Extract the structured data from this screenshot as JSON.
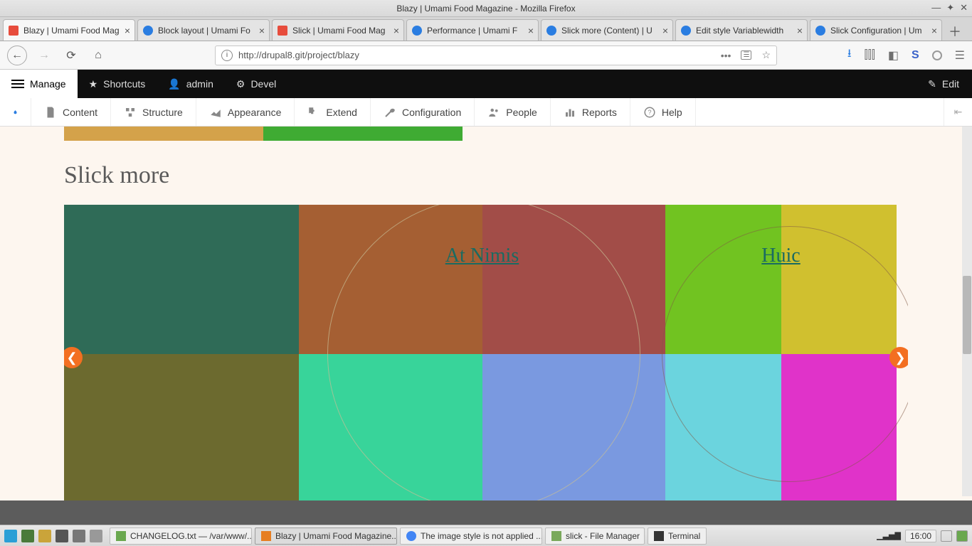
{
  "window": {
    "title": "Blazy | Umami Food Magazine - Mozilla Firefox"
  },
  "tabs": [
    {
      "label": "Blazy | Umami Food Mag",
      "icon": "red"
    },
    {
      "label": "Block layout | Umami Fo",
      "icon": "blue"
    },
    {
      "label": "Slick | Umami Food Mag",
      "icon": "red"
    },
    {
      "label": "Performance | Umami F",
      "icon": "blue"
    },
    {
      "label": "Slick more (Content) | U",
      "icon": "blue"
    },
    {
      "label": "Edit style Variablewidth",
      "icon": "blue"
    },
    {
      "label": "Slick Configuration | Um",
      "icon": "blue"
    }
  ],
  "url": "http://drupal8.git/project/blazy",
  "drupalBar": {
    "manage": "Manage",
    "shortcuts": "Shortcuts",
    "admin": "admin",
    "devel": "Devel",
    "edit": "Edit"
  },
  "adminMenu": {
    "content": "Content",
    "structure": "Structure",
    "appearance": "Appearance",
    "extend": "Extend",
    "configuration": "Configuration",
    "people": "People",
    "reports": "Reports",
    "help": "Help"
  },
  "page": {
    "heading": "Slick more",
    "slide1_caption": "At Nimis",
    "slide2_caption": "Huic"
  },
  "taskbar": {
    "items": [
      "CHANGELOG.txt — /var/www/...",
      "Blazy | Umami Food Magazine...",
      "The image style is not applied ...",
      "slick - File Manager",
      "Terminal"
    ],
    "time": "16:00"
  }
}
